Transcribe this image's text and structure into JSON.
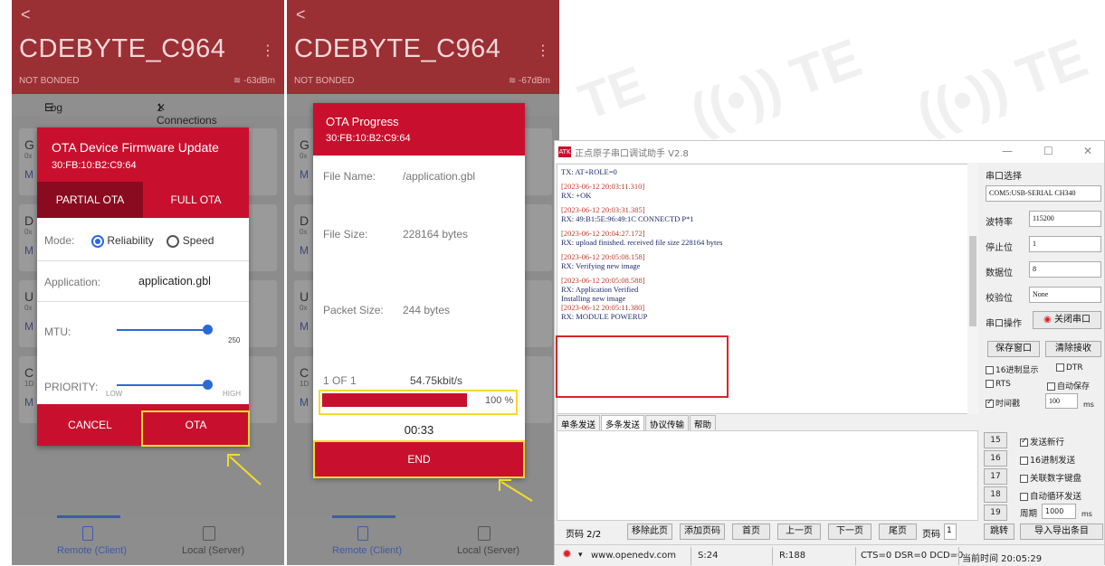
{
  "phone1": {
    "back": "<",
    "device_name": "CDEBYTE_C964",
    "menu": "⋮",
    "bond_status": "NOT BONDED",
    "rssi": "-63dBm",
    "tab_log": "Log",
    "tab_connections": "1 Connections",
    "cards": [
      {
        "letter": "G",
        "sub": "0x",
        "link": "M"
      },
      {
        "letter": "D",
        "sub": "0x",
        "link": "M"
      },
      {
        "letter": "U",
        "sub": "0x",
        "link": "M"
      },
      {
        "letter": "C",
        "sub": "1D",
        "link": "M"
      }
    ],
    "dialog": {
      "title": "OTA Device Firmware Update",
      "address": "30:FB:10:B2:C9:64",
      "tab_partial": "PARTIAL OTA",
      "tab_full": "FULL OTA",
      "mode_label": "Mode:",
      "mode_reliability": "Reliability",
      "mode_speed": "Speed",
      "application_label": "Application:",
      "application_value": "application.gbl",
      "mtu_label": "MTU:",
      "mtu_value": "250",
      "priority_label": "PRIORITY:",
      "priority_low": "LOW",
      "priority_high": "HIGH",
      "cancel": "CANCEL",
      "ota": "OTA"
    },
    "bottom_remote": "Remote (Client)",
    "bottom_local": "Local (Server)"
  },
  "phone2": {
    "back": "<",
    "device_name": "CDEBYTE_C964",
    "menu": "⋮",
    "bond_status": "NOT BONDED",
    "rssi": "-67dBm",
    "cards": [
      {
        "letter": "G",
        "sub": "0x",
        "link": "M"
      },
      {
        "letter": "D",
        "sub": "0x",
        "link": "M"
      },
      {
        "letter": "U",
        "sub": "0x",
        "link": "M"
      },
      {
        "letter": "C",
        "sub": "1D",
        "link": "M"
      }
    ],
    "dialog": {
      "title": "OTA Progress",
      "address": "30:FB:10:B2:C9:64",
      "file_name_label": "File Name:",
      "file_name_value": "/application.gbl",
      "file_size_label": "File Size:",
      "file_size_value": "228164 bytes",
      "packet_size_label": "Packet Size:",
      "packet_size_value": "244 bytes",
      "progress_count": "1 OF 1",
      "speed": "54.75kbit/s",
      "percent": "100 %",
      "progress_fraction": 1.0,
      "elapsed": "00:33",
      "end": "END"
    },
    "bottom_remote": "Remote (Client)",
    "bottom_local": "Local (Server)"
  },
  "serial": {
    "title": "正点原子串口调试助手 V2.8",
    "log": [
      {
        "ts": "",
        "line": "TX: AT+ROLE=0"
      },
      {
        "ts": "[2023-06-12 20:03:11.310]",
        "line": "RX: +OK"
      },
      {
        "ts": "[2023-06-12 20:03:31.385]",
        "line": "RX: 49:B1:5E:96:49:1C CONNECTD P*1"
      },
      {
        "ts": "[2023-06-12 20:04:27.172]",
        "line": "RX: upload finished. received file size 228164 bytes"
      },
      {
        "ts": "[2023-06-12 20:05:08.158]",
        "line": "RX: Verifying new image"
      },
      {
        "ts": "[2023-06-12 20:05:08.588]",
        "line": "RX: Application Verified"
      },
      {
        "ts": "",
        "line": "Installing new image"
      },
      {
        "ts": "[2023-06-12 20:05:11.380]",
        "line": "RX: MODULE POWERUP"
      }
    ],
    "port_label": "串口选择",
    "port_value": "COM5:USB-SERIAL CH340",
    "baud_label": "波特率",
    "baud_value": "115200",
    "stop_label": "停止位",
    "stop_value": "1",
    "data_label": "数据位",
    "data_value": "8",
    "parity_label": "校验位",
    "parity_value": "None",
    "op_label": "串口操作",
    "close_port": "关闭串口",
    "save_window": "保存窗口",
    "clear_recv": "清除接收",
    "hex_display": "16进制显示",
    "dtr": "DTR",
    "rts": "RTS",
    "auto_save": "自动保存",
    "timestamp": "时间戳",
    "timestamp_value": "100",
    "ms": "ms",
    "tabs": [
      "单条发送",
      "多条发送",
      "协议传输",
      "帮助"
    ],
    "nums": [
      "15",
      "16",
      "17",
      "18",
      "19"
    ],
    "send_newline": "发送新行",
    "hex_send": "16进制发送",
    "assoc_keypad": "关联数字键盘",
    "auto_loop": "自动循环发送",
    "period_label": "周期",
    "period_value": "1000",
    "page_label": "页码 2/2",
    "remove_page": "移除此页",
    "add_page": "添加页码",
    "first_page": "首页",
    "prev_page": "上一页",
    "next_page": "下一页",
    "last_page": "尾页",
    "page_num_label": "页码",
    "page_num_value": "1",
    "jump": "跳转",
    "import_export": "导入导出条目",
    "url": "www.openedv.com",
    "s_count": "S:24",
    "r_count": "R:188",
    "cts": "CTS=0 DSR=0 DCD=0",
    "current_time": "当前时间 20:05:29"
  },
  "colors": {
    "accent": "#c8102e",
    "highlight": "#f2dc2b",
    "dim_header": "#9a2f34"
  }
}
